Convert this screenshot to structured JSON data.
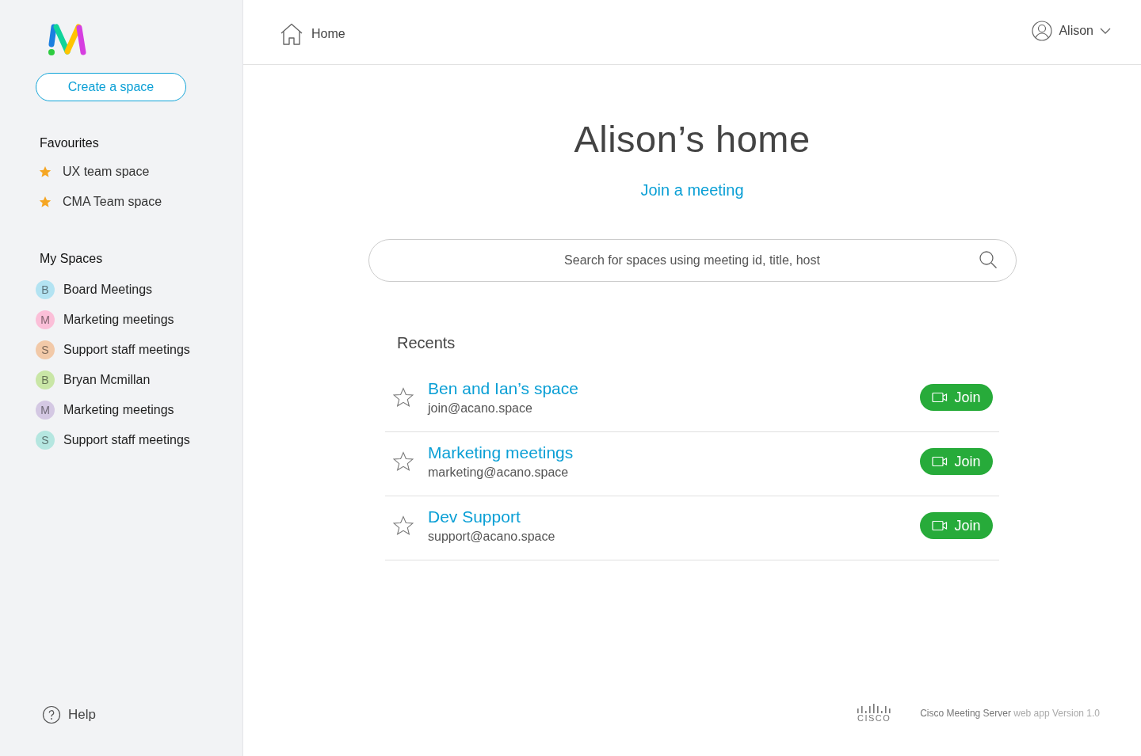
{
  "sidebar": {
    "create_button": "Create a space",
    "favourites": {
      "heading": "Favourites",
      "items": [
        {
          "label": "UX team space"
        },
        {
          "label": "CMA Team space"
        }
      ]
    },
    "my_spaces": {
      "heading": "My Spaces",
      "items": [
        {
          "initial": "B",
          "label": "Board Meetings",
          "color": "#b3e3f2"
        },
        {
          "initial": "M",
          "label": "Marketing meetings",
          "color": "#fbbfd8"
        },
        {
          "initial": "S",
          "label": "Support staff meetings",
          "color": "#f2c9a8"
        },
        {
          "initial": "B",
          "label": "Bryan Mcmillan",
          "color": "#c9e6a6"
        },
        {
          "initial": "M",
          "label": "Marketing meetings",
          "color": "#d4c8e3"
        },
        {
          "initial": "S",
          "label": "Support staff meetings",
          "color": "#b5e6e0"
        }
      ]
    },
    "help": "Help"
  },
  "header": {
    "breadcrumb": "Home",
    "user": "Alison"
  },
  "main": {
    "title": "Alison’s home",
    "join_link": "Join a meeting",
    "search": {
      "placeholder": "Search for spaces using meeting id, title, host"
    },
    "recents": {
      "heading": "Recents",
      "items": [
        {
          "name": "Ben and Ian’s space",
          "address": "join@acano.space",
          "favourite": false,
          "button": "Join"
        },
        {
          "name": "Marketing meetings",
          "address": "marketing@acano.space",
          "favourite": false,
          "button": "Join"
        },
        {
          "name": "Dev Support",
          "address": "support@acano.space",
          "favourite": false,
          "button": "Join"
        }
      ]
    }
  },
  "footer": {
    "logo_text": "CISCO",
    "product": "Cisco Meeting Server",
    "version": "web app Version 1.0"
  }
}
